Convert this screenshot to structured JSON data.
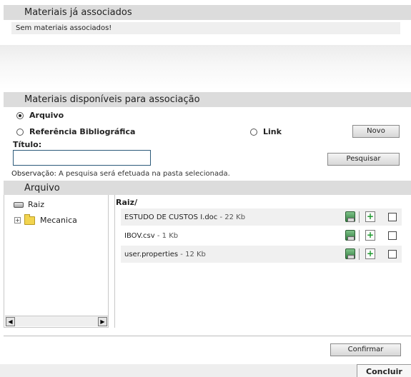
{
  "associated": {
    "title": "Materiais já associados",
    "empty_text": "Sem materiais associados!"
  },
  "available": {
    "title": "Materiais disponíveis para associação",
    "radio_arquivo": "Arquivo",
    "radio_referencia": "Referência Bibliográfica",
    "radio_link": "Link",
    "selected": "Arquivo",
    "novo_label": "Novo",
    "titulo_label": "Título:",
    "titulo_value": "",
    "pesquisar_label": "Pesquisar",
    "note_label": "Observação:",
    "note_text": " A pesquisa será efetuada na pasta selecionada."
  },
  "arquivo": {
    "title": "Arquivo",
    "tree": {
      "root_label": "Raiz",
      "root_icon": "hard-drive-icon",
      "folder_label": "Mecanica",
      "folder_icon": "folder-icon",
      "expander": "+"
    },
    "path": "Raiz/",
    "files": [
      {
        "name": "ESTUDO DE CUSTOS I.doc",
        "size": " - 22 Kb"
      },
      {
        "name": "IBOV.csv",
        "size": " - 1 Kb"
      },
      {
        "name": "user.properties",
        "size": " - 12 Kb"
      }
    ],
    "scroll_left": "◀",
    "scroll_right": "▶"
  },
  "confirmar_label": "Confirmar",
  "concluir_label": "Concluir"
}
